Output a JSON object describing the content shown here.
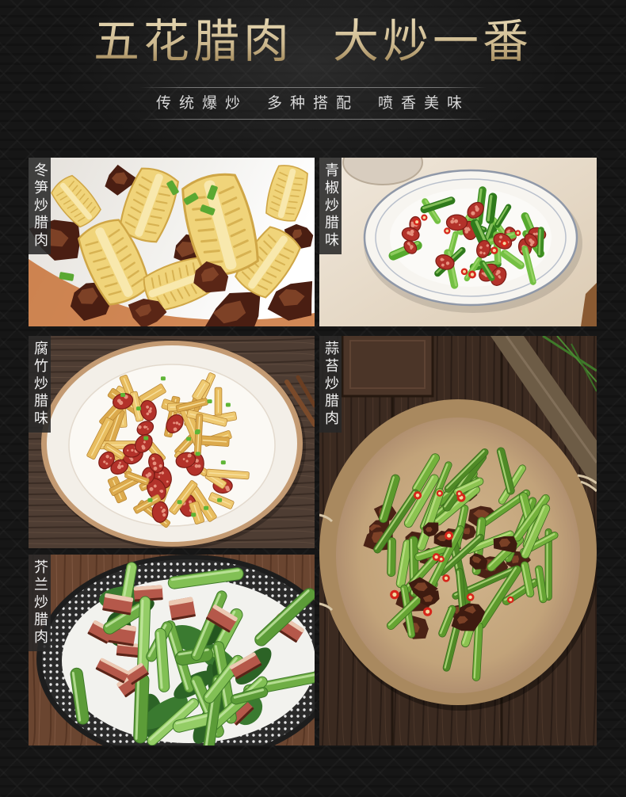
{
  "header": {
    "title_part1": "五花腊肉",
    "title_part2": "大炒一番",
    "subtitle": [
      "传统爆炒",
      "多种搭配",
      "喷香美味"
    ]
  },
  "dishes": [
    {
      "label": "冬笋炒腊肉"
    },
    {
      "label": "青椒炒腊味"
    },
    {
      "label": "腐竹炒腊味"
    },
    {
      "label": "蒜苔炒腊肉"
    },
    {
      "label": "芥兰炒腊肉"
    }
  ],
  "colors": {
    "background": "#161616",
    "title_gold": "#cdb98f",
    "subtitle_text": "#d9d9d9",
    "label_box": "rgba(40,40,40,0.88)",
    "label_text": "#f2f2f2"
  }
}
